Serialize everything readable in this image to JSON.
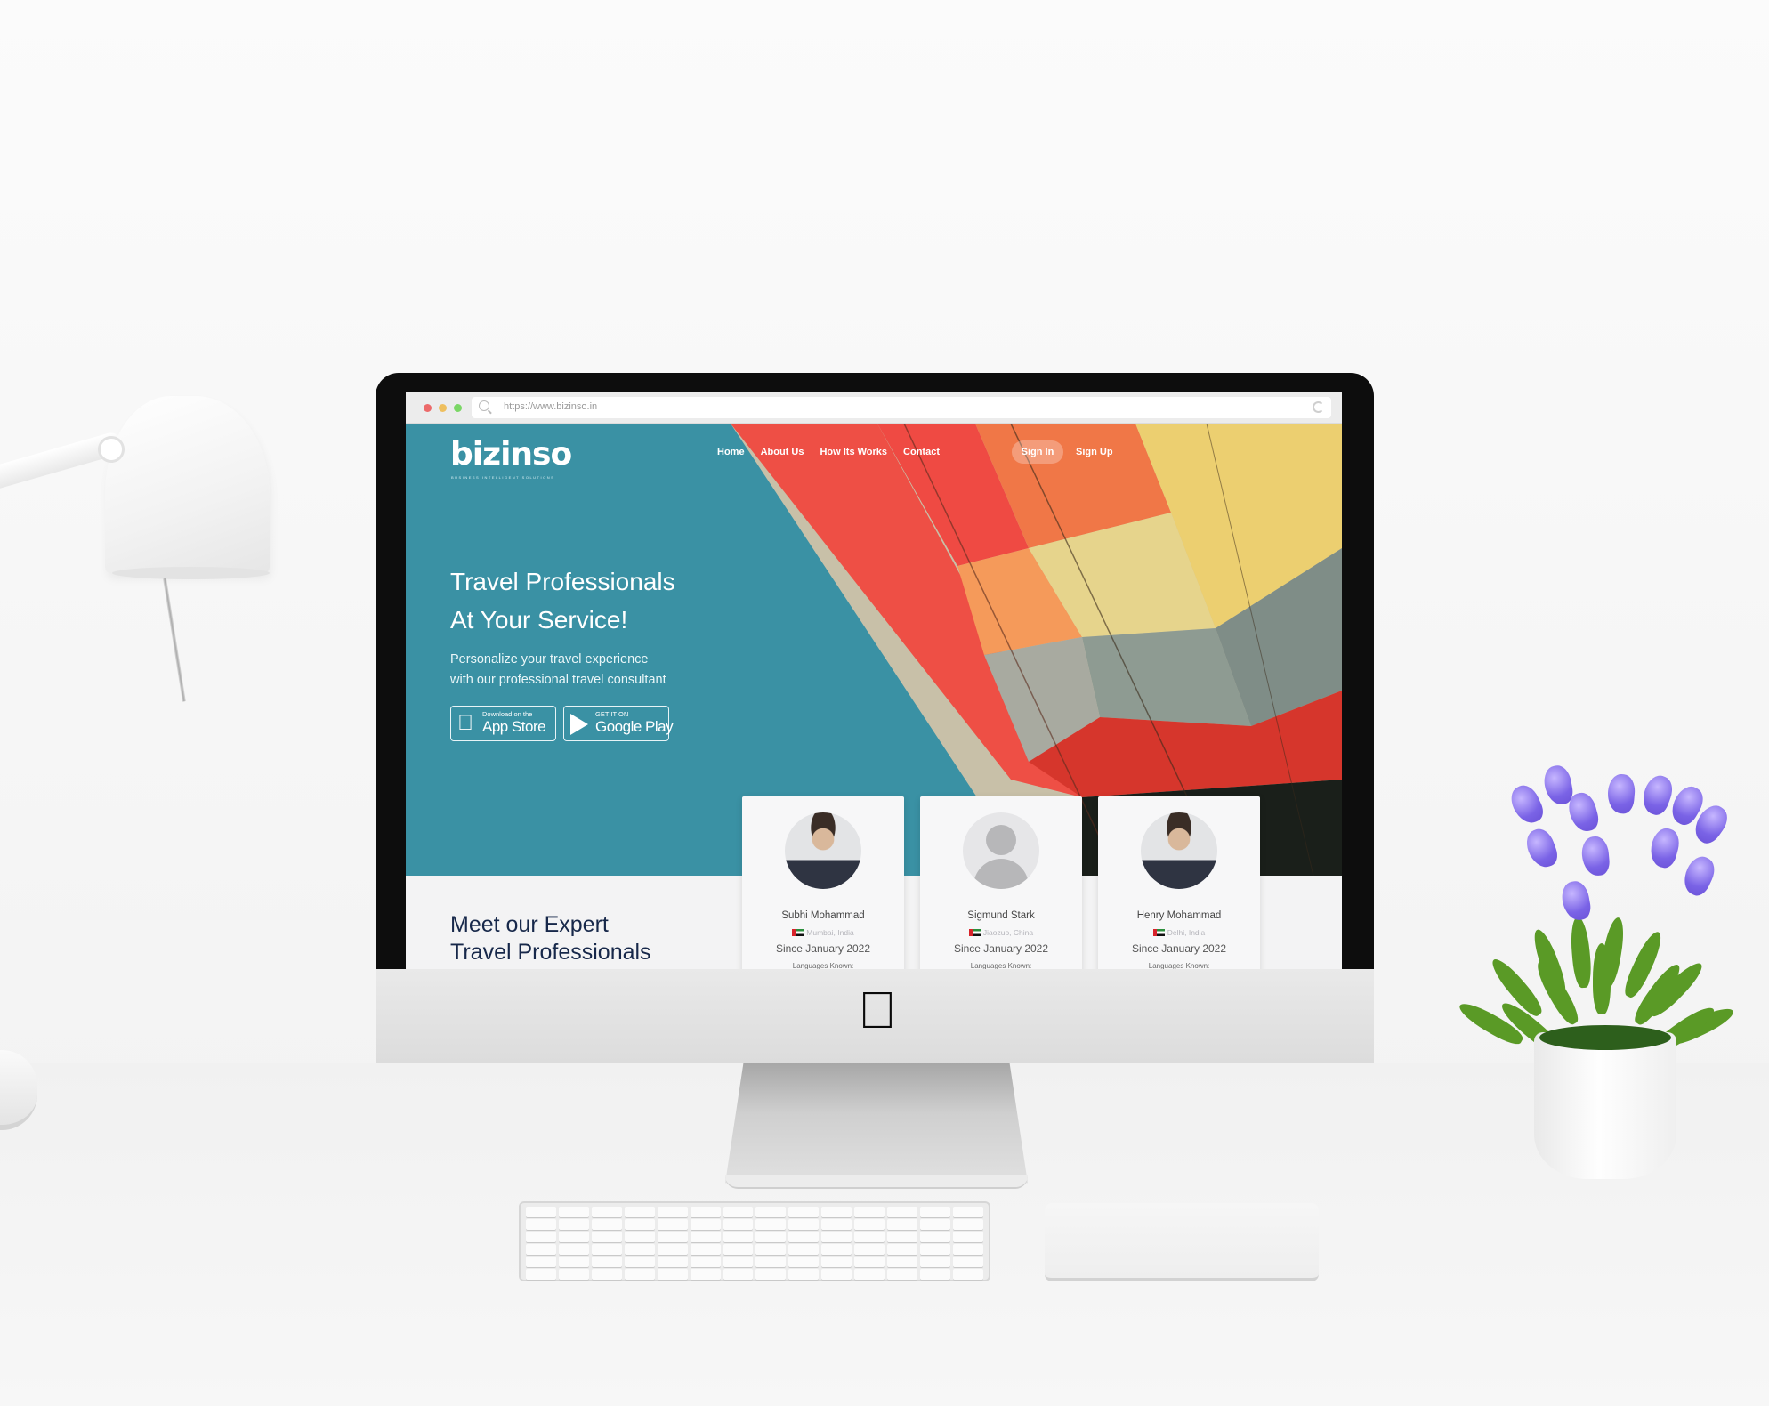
{
  "browser": {
    "url": "https://www.bizinso.in"
  },
  "site": {
    "logo": "bizinso",
    "logo_tagline": "BUSINESS INTELLIGENT SOLUTIONS",
    "nav": [
      {
        "label": "Home"
      },
      {
        "label": "About Us"
      },
      {
        "label": "How Its Works"
      },
      {
        "label": "Contact"
      }
    ],
    "sign_in": "Sign In",
    "sign_up": "Sign Up",
    "hero": {
      "title_line1": "Travel Professionals",
      "title_line2": "At Your Service!",
      "subtitle_line1": "Personalize your travel experience",
      "subtitle_line2": "with our professional travel consultant",
      "app_store_small": "Download on the",
      "app_store_big": "App Store",
      "google_play_small": "GET IT ON",
      "google_play_big": "Google Play"
    },
    "section": {
      "title_line1": "Meet our Expert",
      "title_line2": "Travel Professionals"
    },
    "professionals": [
      {
        "name": "Subhi Mohammad",
        "location": "Mumbai, India",
        "since": "Since January 2022",
        "languages_label": "Languages Known:",
        "avatar": "photo"
      },
      {
        "name": "Sigmund Stark",
        "location": "Jiaozuo, China",
        "since": "Since January 2022",
        "languages_label": "Languages Known:",
        "avatar": "default"
      },
      {
        "name": "Henry Mohammad",
        "location": "Delhi, India",
        "since": "Since January 2022",
        "languages_label": "Languages Known:",
        "avatar": "photo"
      }
    ],
    "colors": {
      "hero_teal": "#3a91a4",
      "heading_navy": "#17284a"
    }
  }
}
